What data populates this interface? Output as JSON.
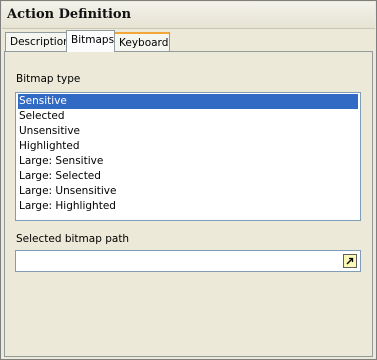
{
  "window": {
    "title": "Action Definition"
  },
  "tabs": [
    {
      "label": "Description"
    },
    {
      "label": "Bitmaps"
    },
    {
      "label": "Keyboard"
    }
  ],
  "active_tab": "Bitmaps",
  "bitmap_type": {
    "label": "Bitmap type",
    "items": [
      "Sensitive",
      "Selected",
      "Unsensitive",
      "Highlighted",
      "Large: Sensitive",
      "Large: Selected",
      "Large: Unsensitive",
      "Large: Highlighted"
    ],
    "selected": "Sensitive"
  },
  "bitmap_path": {
    "label": "Selected bitmap path",
    "value": "",
    "browse_icon": "arrow-browse-icon"
  },
  "colors": {
    "selection": "#316ac5",
    "keyboard_tab_accent": "#f2a73b",
    "browse_button": "#fbf7b5"
  }
}
